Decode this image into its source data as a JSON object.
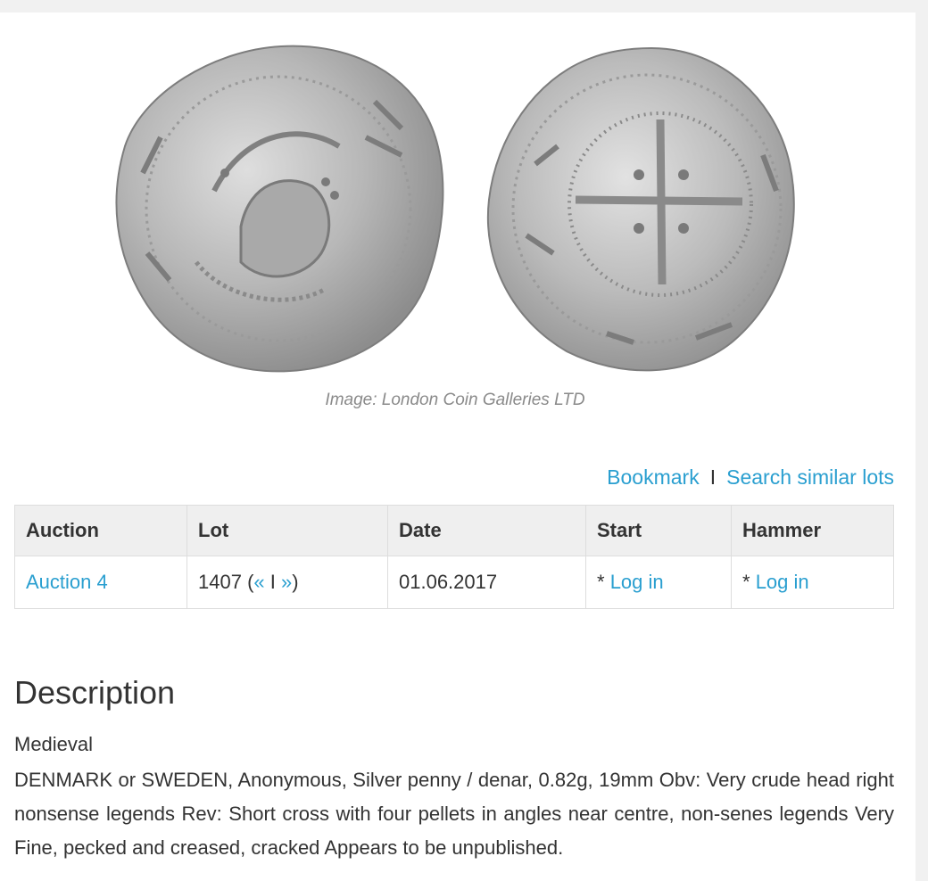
{
  "image": {
    "caption": "Image: London Coin Galleries LTD",
    "obverse_icon": "coin-obverse-head-icon",
    "reverse_icon": "coin-reverse-cross-icon"
  },
  "actions": {
    "bookmark": "Bookmark",
    "separator": "I",
    "search_similar": "Search similar lots"
  },
  "table": {
    "headers": [
      "Auction",
      "Lot",
      "Date",
      "Start",
      "Hammer"
    ],
    "row": {
      "auction": "Auction 4",
      "lot_number": "1407",
      "lot_open": "(",
      "prev": "«",
      "nav_sep": "I",
      "next": "»",
      "lot_close": ")",
      "date": "01.06.2017",
      "start_prefix": "*",
      "start_login": "Log in",
      "hammer_prefix": "*",
      "hammer_login": "Log in"
    }
  },
  "description": {
    "title": "Description",
    "category": "Medieval",
    "text": "DENMARK or SWEDEN, Anonymous, Silver penny / denar, 0.82g, 19mm Obv: Very crude head right nonsense legends Rev: Short cross with four pellets in angles near centre, non-senes legends Very Fine, pecked and creased, cracked Appears to be unpublished."
  },
  "colors": {
    "link": "#2a9fd0",
    "text": "#333333",
    "caption": "#8a8a8a",
    "table_header_bg": "#efefef",
    "border": "#dddddd",
    "coin_silver": "#b9b9b9"
  }
}
